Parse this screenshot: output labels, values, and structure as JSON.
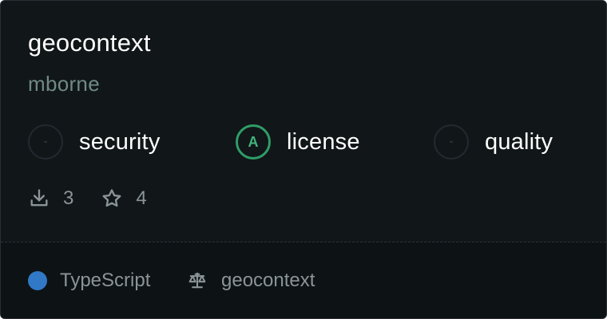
{
  "package": {
    "name": "geocontext",
    "owner": "mborne"
  },
  "metrics": [
    {
      "label": "security",
      "grade": "-",
      "state": "ungraded",
      "icon": "dash-icon"
    },
    {
      "label": "license",
      "grade": "A",
      "state": "graded",
      "icon": "grade-icon"
    },
    {
      "label": "quality",
      "grade": "-",
      "state": "ungraded",
      "icon": "dash-icon"
    }
  ],
  "stats": {
    "downloads": "3",
    "stars": "4",
    "downloads_icon": "download-icon",
    "stars_icon": "star-icon"
  },
  "footer": {
    "language": "TypeScript",
    "language_color": "#3178c6",
    "license": "geocontext",
    "license_icon": "scale-icon"
  },
  "colors": {
    "card_background": "#111619",
    "footer_background": "#0d1214",
    "grade_accent": "#2f9d66",
    "muted_text": "#8b9497",
    "owner_text": "#6f8a84"
  }
}
